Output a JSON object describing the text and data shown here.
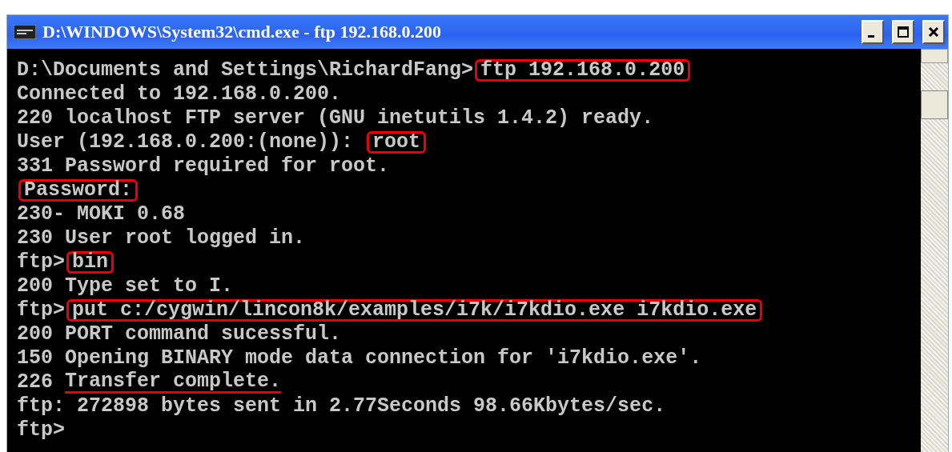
{
  "window": {
    "title": "D:\\WINDOWS\\System32\\cmd.exe - ftp 192.168.0.200"
  },
  "console": {
    "lines": [
      {
        "parts": [
          {
            "text": "D:\\Documents and Settings\\RichardFang>"
          },
          {
            "text": "ftp 192.168.0.200",
            "kind": "boxed"
          }
        ]
      },
      {
        "parts": [
          {
            "text": "Connected to 192.168.0.200."
          }
        ]
      },
      {
        "parts": [
          {
            "text": "220 localhost FTP server (GNU inetutils 1.4.2) ready."
          }
        ]
      },
      {
        "parts": [
          {
            "text": "User (192.168.0.200:(none)): "
          },
          {
            "text": "root",
            "kind": "boxed"
          }
        ]
      },
      {
        "parts": [
          {
            "text": "331 Password required for root."
          }
        ]
      },
      {
        "parts": [
          {
            "text": "Password:",
            "kind": "boxed"
          }
        ]
      },
      {
        "parts": [
          {
            "text": "230- MOKI 0.68"
          }
        ]
      },
      {
        "parts": [
          {
            "text": "230 User root logged in."
          }
        ]
      },
      {
        "parts": [
          {
            "text": "ftp>"
          },
          {
            "text": "bin",
            "kind": "boxed"
          }
        ]
      },
      {
        "parts": [
          {
            "text": "200 Type set to I."
          }
        ]
      },
      {
        "parts": [
          {
            "text": "ftp>"
          },
          {
            "text": "put c:/cygwin/lincon8k/examples/i7k/i7kdio.exe i7kdio.exe",
            "kind": "boxed"
          }
        ]
      },
      {
        "parts": [
          {
            "text": "200 PORT command sucessful."
          }
        ]
      },
      {
        "parts": [
          {
            "text": "150 Opening BINARY mode data connection for 'i7kdio.exe'."
          }
        ]
      },
      {
        "parts": [
          {
            "text": "226 "
          },
          {
            "text": "Transfer complete.",
            "kind": "underlined"
          }
        ]
      },
      {
        "parts": [
          {
            "text": "ftp: 272898 bytes sent in 2.77Seconds 98.66Kbytes/sec."
          }
        ]
      },
      {
        "parts": [
          {
            "text": "ftp>"
          }
        ]
      }
    ]
  }
}
